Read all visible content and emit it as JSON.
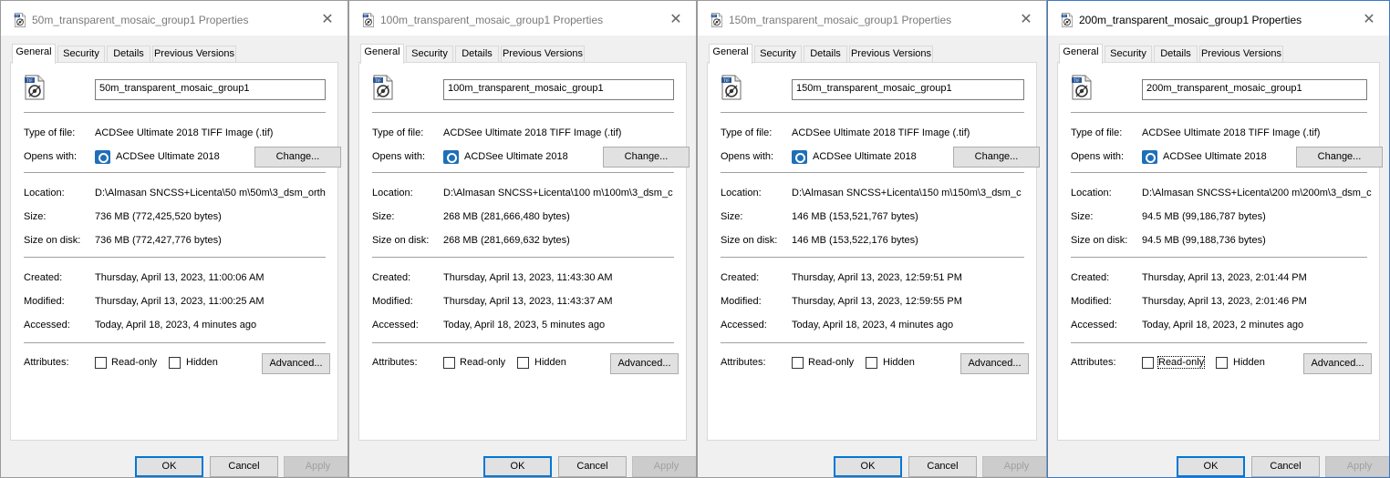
{
  "shared": {
    "tabs": [
      "General",
      "Security",
      "Details",
      "Previous Versions"
    ],
    "labels": {
      "type_of_file": "Type of file:",
      "opens_with": "Opens with:",
      "location": "Location:",
      "size": "Size:",
      "size_on_disk": "Size on disk:",
      "created": "Created:",
      "modified": "Modified:",
      "accessed": "Accessed:",
      "attributes": "Attributes:"
    },
    "type_of_file": "ACDSee Ultimate 2018 TIFF Image (.tif)",
    "opens_with": "ACDSee Ultimate 2018",
    "change_label": "Change...",
    "readonly_label": "Read-only",
    "hidden_label": "Hidden",
    "advanced_label": "Advanced...",
    "ok_label": "OK",
    "cancel_label": "Cancel",
    "apply_label": "Apply",
    "close_glyph": "✕"
  },
  "dialogs": [
    {
      "title": "50m_transparent_mosaic_group1 Properties",
      "filename": "50m_transparent_mosaic_group1",
      "location": "D:\\Almasan SNCSS+Licenta\\50 m\\50m\\3_dsm_orth",
      "size": "736 MB (772,425,520 bytes)",
      "size_on_disk": "736 MB (772,427,776 bytes)",
      "created": "Thursday, April 13, 2023, 11:00:06 AM",
      "modified": "Thursday, April 13, 2023, 11:00:25 AM",
      "accessed": "Today, April 18, 2023, 4 minutes ago"
    },
    {
      "title": "100m_transparent_mosaic_group1 Properties",
      "filename": "100m_transparent_mosaic_group1",
      "location": "D:\\Almasan SNCSS+Licenta\\100 m\\100m\\3_dsm_c",
      "size": "268 MB (281,666,480 bytes)",
      "size_on_disk": "268 MB (281,669,632 bytes)",
      "created": "Thursday, April 13, 2023, 11:43:30 AM",
      "modified": "Thursday, April 13, 2023, 11:43:37 AM",
      "accessed": "Today, April 18, 2023, 5 minutes ago"
    },
    {
      "title": "150m_transparent_mosaic_group1 Properties",
      "filename": "150m_transparent_mosaic_group1",
      "location": "D:\\Almasan SNCSS+Licenta\\150 m\\150m\\3_dsm_c",
      "size": "146 MB (153,521,767 bytes)",
      "size_on_disk": "146 MB (153,522,176 bytes)",
      "created": "Thursday, April 13, 2023, 12:59:51 PM",
      "modified": "Thursday, April 13, 2023, 12:59:55 PM",
      "accessed": "Today, April 18, 2023, 4 minutes ago"
    },
    {
      "title": "200m_transparent_mosaic_group1 Properties",
      "filename": "200m_transparent_mosaic_group1",
      "location": "D:\\Almasan SNCSS+Licenta\\200 m\\200m\\3_dsm_c",
      "size": "94.5 MB (99,186,787 bytes)",
      "size_on_disk": "94.5 MB (99,188,736 bytes)",
      "created": "Thursday, April 13, 2023, 2:01:44 PM",
      "modified": "Thursday, April 13, 2023, 2:01:46 PM",
      "accessed": "Today, April 18, 2023, 2 minutes ago"
    }
  ],
  "colors": {
    "dialog_bg": "#f0f0f0",
    "panel_bg": "#ffffff",
    "active_border": "#3a7ac6",
    "default_button_border": "#0078d7",
    "app_icon": "#1f6fb8"
  },
  "icons": {
    "title_icon": "tiff-file-icon",
    "file_icon": "tiff-image-file-icon",
    "app_icon": "acdsee-app-icon",
    "close": "close-icon"
  }
}
